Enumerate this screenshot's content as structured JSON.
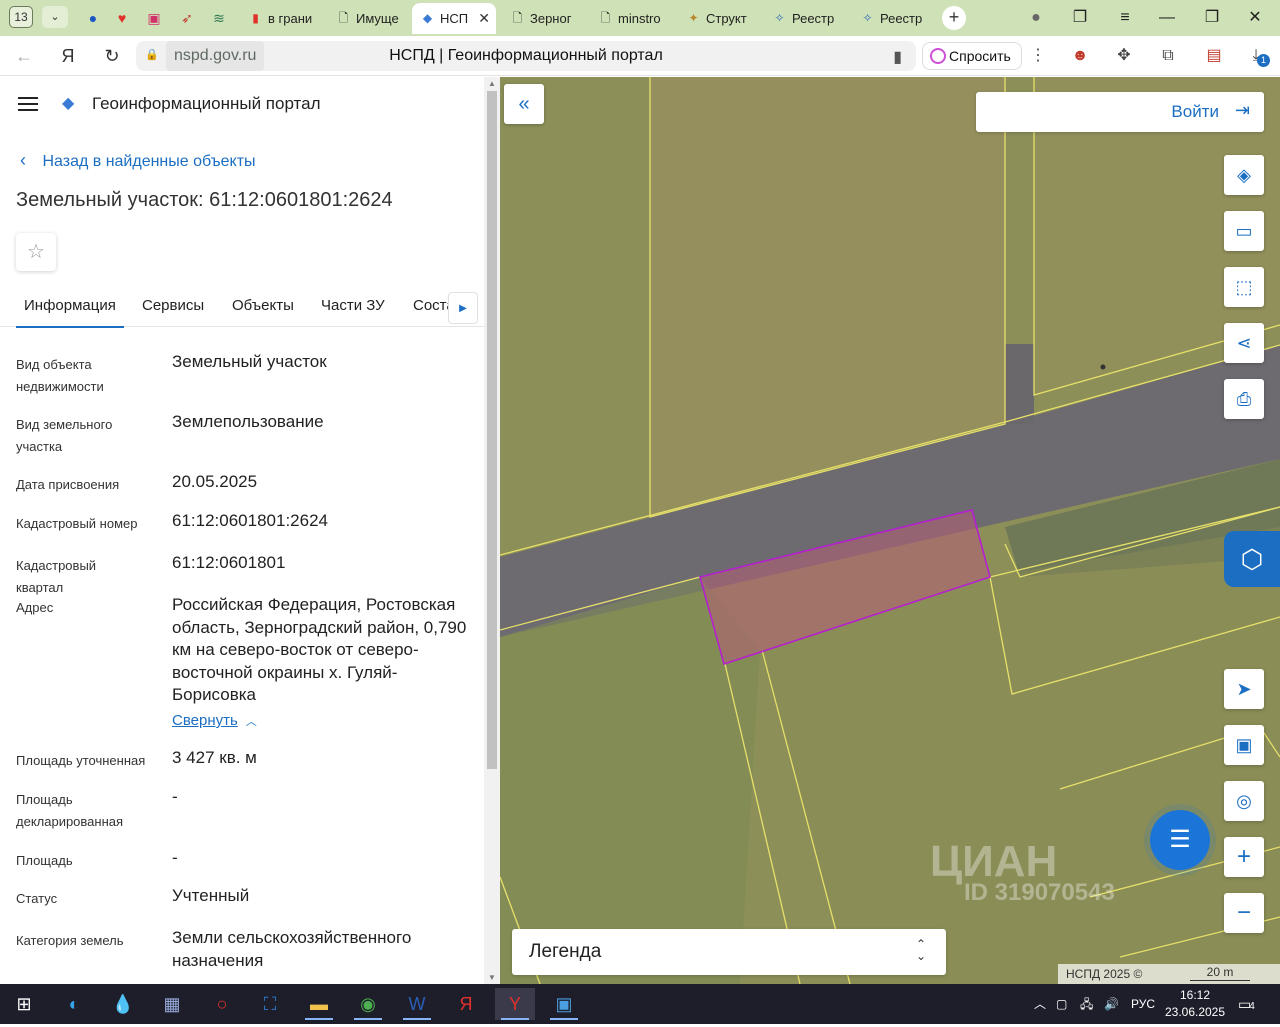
{
  "browser": {
    "tab_count": "13",
    "tabs": [
      {
        "label": "в грани",
        "favicon": "yandex-doc-icon"
      },
      {
        "label": "Имуще",
        "favicon": "document-icon"
      },
      {
        "label": "НСП",
        "favicon": "nspd-icon",
        "active": true
      },
      {
        "label": "Зерног",
        "favicon": "document-icon"
      },
      {
        "label": "minstro",
        "favicon": "document-icon"
      },
      {
        "label": "Структ",
        "favicon": "emblem-icon"
      },
      {
        "label": "Реестр",
        "favicon": "rosreestr-icon"
      },
      {
        "label": "Реестр",
        "favicon": "rosreestr-icon"
      }
    ],
    "url": "nspd.gov.ru",
    "page_title": "НСПД | Геоинформационный портал",
    "ask_label": "Спросить",
    "download_badge": "1"
  },
  "panel": {
    "portal_name": "Геоинформационный портал",
    "back_label": "Назад в найденные объекты",
    "title": "Земельный участок: 61:12:0601801:2624",
    "tabs": [
      "Информация",
      "Сервисы",
      "Объекты",
      "Части ЗУ",
      "Соста..."
    ],
    "rows": [
      {
        "label": "Вид объекта недвижимости",
        "value": "Земельный участок"
      },
      {
        "label": "Вид земельного участка",
        "value": "Землепользование"
      },
      {
        "label": "Дата присвоения",
        "value": "20.05.2025"
      },
      {
        "label": "Кадастровый номер",
        "value": "61:12:0601801:2624"
      },
      {
        "label": "Кадастровый квартал",
        "value": "61:12:0601801"
      },
      {
        "label": "Адрес",
        "value": "Российская Федерация, Ростовская область, Зерноградский район, 0,790 км на северо-восток от северо-восточной окраины х. Гуляй-Борисовка"
      },
      {
        "label": "Площадь уточненная",
        "value": "3 427 кв. м"
      },
      {
        "label": "Площадь декларированная",
        "value": "-"
      },
      {
        "label": "Площадь",
        "value": "-"
      },
      {
        "label": "Статус",
        "value": "Учтенный"
      },
      {
        "label": "Категория земель",
        "value": "Земли сельскохозяйственного назначения"
      }
    ],
    "collapse_label": "Свернуть"
  },
  "map": {
    "login_label": "Войти",
    "legend_label": "Легенда",
    "copyright": "НСПД 2025 ©",
    "scale_label": "20 m",
    "watermark": "ЦИАН",
    "watermark_id": "ID 319070543",
    "parcel_outline_color": "#b51fd0",
    "boundary_color": "#e6e06a"
  },
  "taskbar": {
    "lang": "РУС",
    "time": "16:12",
    "date": "23.06.2025",
    "notif_count": "4"
  }
}
